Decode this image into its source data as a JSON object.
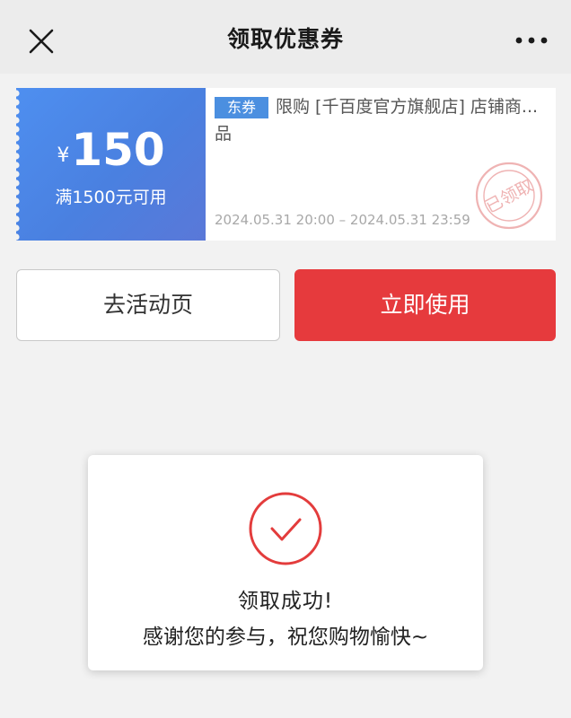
{
  "navbar": {
    "title": "领取优惠券",
    "close_icon": "close-icon",
    "more_icon": "more-icon"
  },
  "coupon": {
    "currency": "¥",
    "amount": "150",
    "condition": "满1500元可用",
    "tag": "东券",
    "description_line1": "限购 [千百度官方旗舰店] 店铺商...",
    "description_line2": "品",
    "stamp_text": "已领取",
    "validity": "2024.05.31 20:00 – 2024.05.31 23:59",
    "colors": {
      "left_bg": "#4e8ff0",
      "tag_bg": "#4b8fe0",
      "stamp": "#e8a0a0"
    }
  },
  "buttons": {
    "activity_label": "去活动页",
    "use_label": "立即使用",
    "use_color": "#e63a3d"
  },
  "toast": {
    "icon": "check-circle-icon",
    "title": "领取成功!",
    "message": "感谢您的参与，祝您购物愉快~",
    "accent": "#e33c3c"
  }
}
